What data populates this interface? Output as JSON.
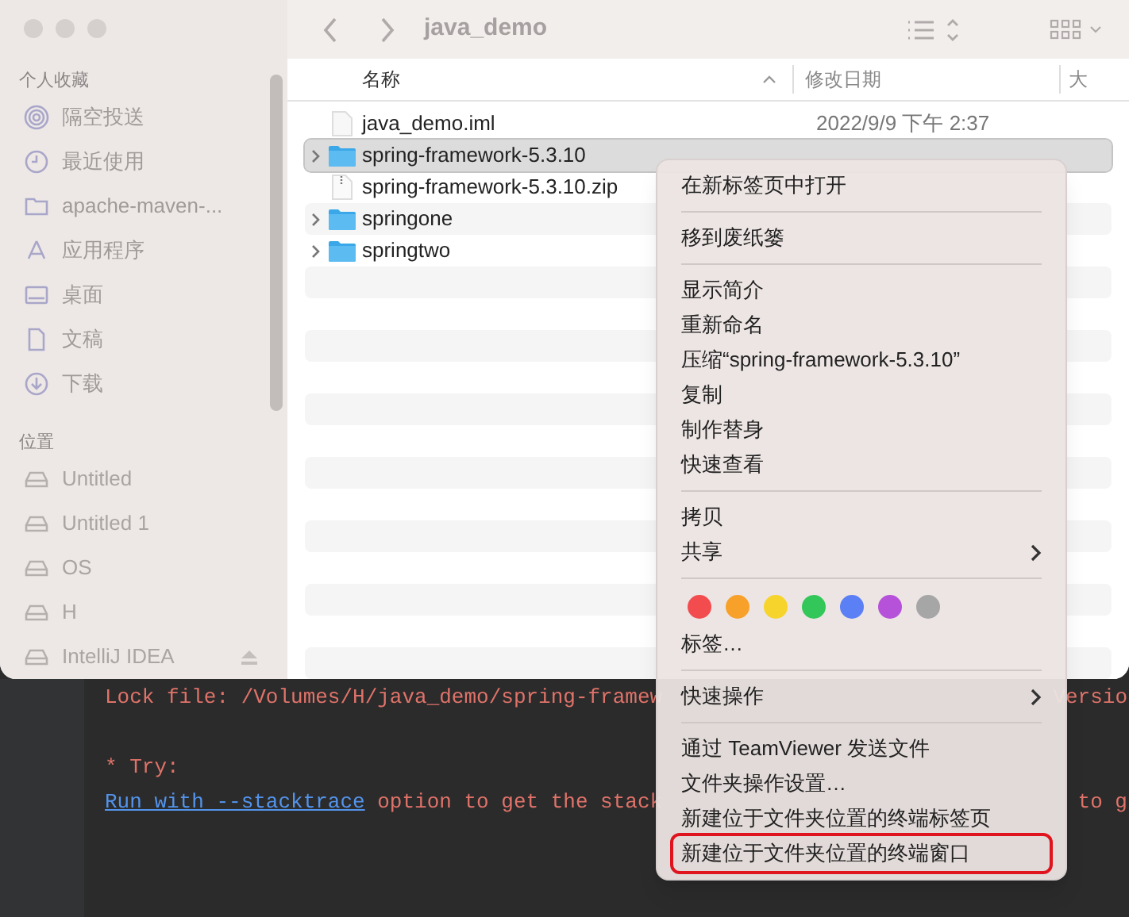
{
  "window": {
    "title": "java_demo"
  },
  "sidebar": {
    "sections": [
      {
        "title": "个人收藏",
        "items": [
          {
            "label": "隔空投送"
          },
          {
            "label": "最近使用"
          },
          {
            "label": "apache-maven-..."
          },
          {
            "label": "应用程序"
          },
          {
            "label": "桌面"
          },
          {
            "label": "文稿"
          },
          {
            "label": "下载"
          }
        ]
      },
      {
        "title": "位置",
        "items": [
          {
            "label": "Untitled",
            "ejectable": false
          },
          {
            "label": "Untitled 1",
            "ejectable": false
          },
          {
            "label": "OS",
            "ejectable": false
          },
          {
            "label": "H",
            "ejectable": false
          },
          {
            "label": "IntelliJ IDEA",
            "ejectable": true
          }
        ]
      }
    ]
  },
  "table": {
    "columns": [
      "名称",
      "修改日期",
      "大"
    ],
    "rows": [
      {
        "name": "java_demo.iml",
        "kind": "file",
        "date": "2022/9/9 下午 2:37",
        "selected": false
      },
      {
        "name": "spring-framework-5.3.10",
        "kind": "folder",
        "selected": true
      },
      {
        "name": "spring-framework-5.3.10.zip",
        "kind": "zip",
        "selected": false
      },
      {
        "name": "springone",
        "kind": "folder",
        "selected": false
      },
      {
        "name": "springtwo",
        "kind": "folder",
        "selected": false
      }
    ]
  },
  "terminal": {
    "lines": [
      {
        "left": "Lock file: /Volumes/H/java_demo/spring-framew",
        "right": "Versio"
      },
      {
        "left": "* Try:"
      },
      {
        "link": "Run with --stacktrace",
        "left": " option to get the stack",
        "right": "to g"
      }
    ]
  },
  "context_menu": {
    "items": [
      {
        "kind": "item",
        "label": "在新标签页中打开"
      },
      {
        "kind": "separator"
      },
      {
        "kind": "item",
        "label": "移到废纸篓"
      },
      {
        "kind": "separator"
      },
      {
        "kind": "item",
        "label": "显示简介"
      },
      {
        "kind": "item",
        "label": "重新命名"
      },
      {
        "kind": "item",
        "label": "压缩“spring-framework-5.3.10”"
      },
      {
        "kind": "item",
        "label": "复制"
      },
      {
        "kind": "item",
        "label": "制作替身"
      },
      {
        "kind": "item",
        "label": "快速查看"
      },
      {
        "kind": "separator"
      },
      {
        "kind": "item",
        "label": "拷贝"
      },
      {
        "kind": "submenu",
        "label": "共享"
      },
      {
        "kind": "separator"
      },
      {
        "kind": "tags",
        "tags": [
          {
            "color": "#f24c4f"
          },
          {
            "color": "#f8a12a"
          },
          {
            "color": "#f7d42b"
          },
          {
            "color": "#33c75a"
          },
          {
            "color": "#5b7ff5"
          },
          {
            "color": "#b552d9"
          },
          {
            "color": "#a6a6a6"
          }
        ]
      },
      {
        "kind": "item",
        "label": "标签…"
      },
      {
        "kind": "separator"
      },
      {
        "kind": "submenu",
        "label": "快速操作"
      },
      {
        "kind": "separator"
      },
      {
        "kind": "item",
        "label": "通过 TeamViewer 发送文件"
      },
      {
        "kind": "item",
        "label": "文件夹操作设置…"
      },
      {
        "kind": "item",
        "label": "新建位于文件夹位置的终端标签页"
      },
      {
        "kind": "item",
        "label": "新建位于文件夹位置的终端窗口",
        "highlighted": true
      }
    ]
  }
}
